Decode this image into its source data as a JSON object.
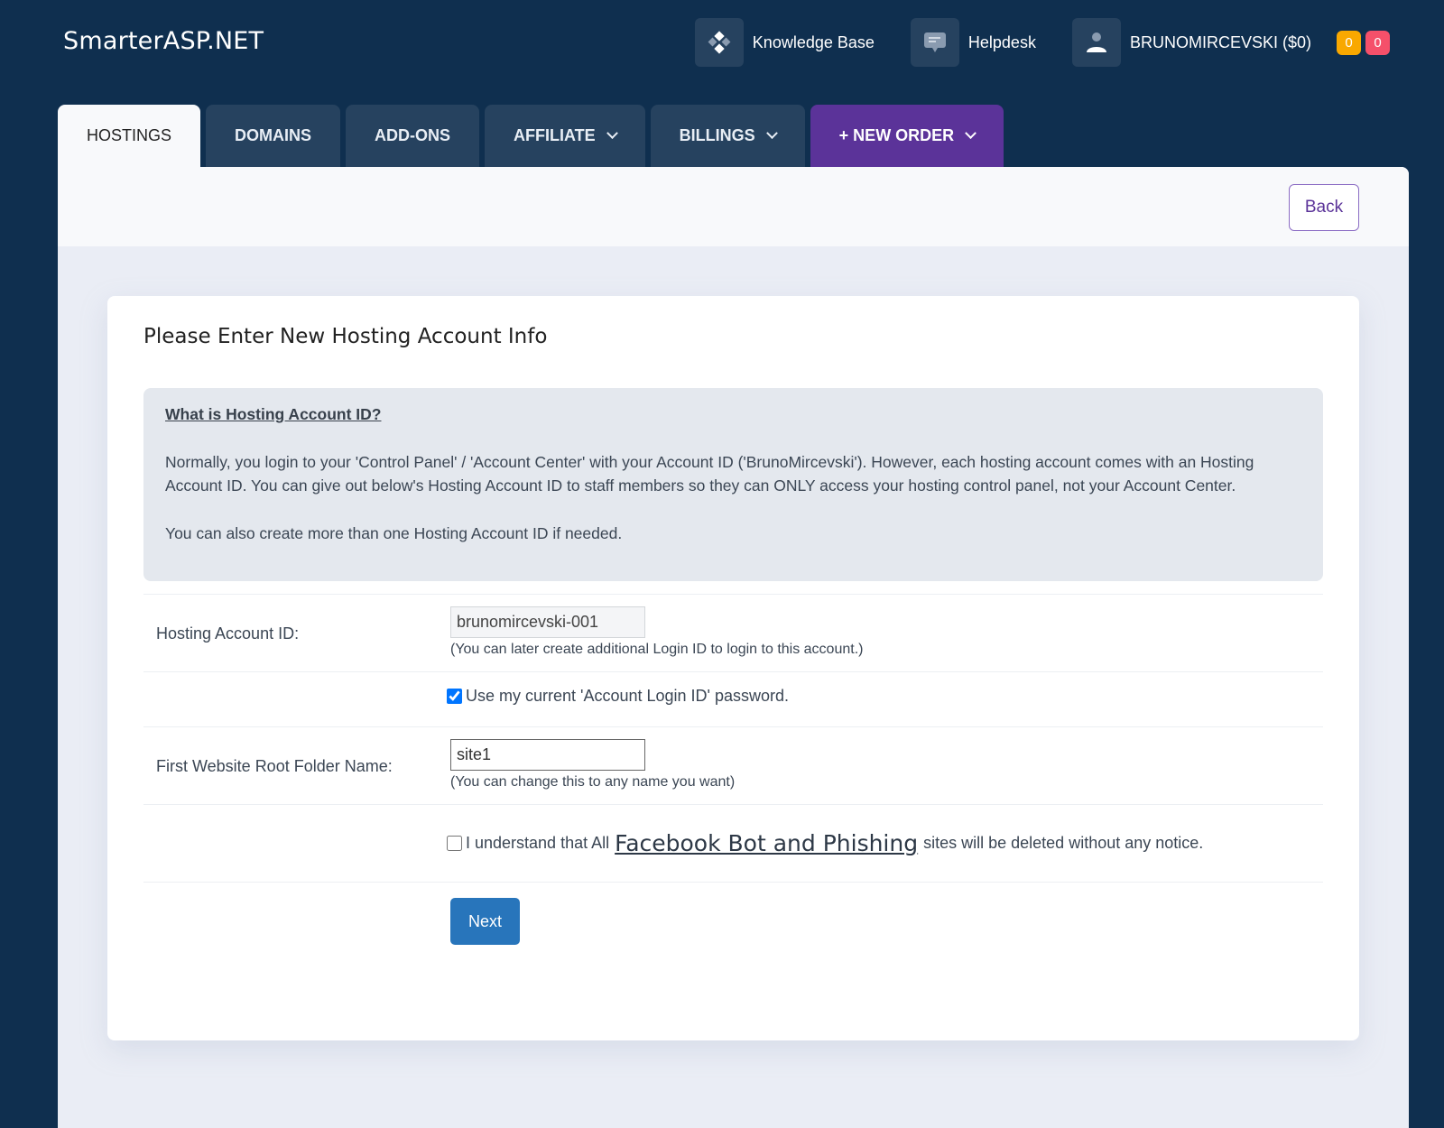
{
  "header": {
    "brand": "SmarterASP.NET",
    "nav": [
      {
        "label": "Knowledge Base",
        "icon": "knowledge-base-icon"
      },
      {
        "label": "Helpdesk",
        "icon": "chat-bubble-icon"
      },
      {
        "label": "BRUNOMIRCEVSKI ($0)",
        "icon": "user-icon"
      }
    ],
    "badges": [
      {
        "value": "0",
        "color": "#f9a800"
      },
      {
        "value": "0",
        "color": "#f5506a"
      }
    ]
  },
  "tabs": [
    {
      "label": "HOSTINGS",
      "active": true,
      "dropdown": false
    },
    {
      "label": "DOMAINS",
      "active": false,
      "dropdown": false
    },
    {
      "label": "ADD-ONS",
      "active": false,
      "dropdown": false
    },
    {
      "label": "AFFILIATE",
      "active": false,
      "dropdown": true
    },
    {
      "label": "BILLINGS",
      "active": false,
      "dropdown": true
    },
    {
      "label": "+ NEW ORDER",
      "active": false,
      "dropdown": true,
      "color": "#5b3399"
    }
  ],
  "toolbar": {
    "back_label": "Back"
  },
  "card": {
    "title": "Please Enter New Hosting Account Info",
    "info": {
      "title": "What is Hosting Account ID?",
      "paragraph1": "Normally, you login to your 'Control Panel' / 'Account Center' with your Account ID ('BrunoMircevski'). However, each hosting account comes with an Hosting Account ID. You can give out below's Hosting Account ID to staff members so they can ONLY access your hosting control panel, not your Account Center.",
      "paragraph2": "You can also create more than one Hosting Account ID if needed."
    },
    "form": {
      "hosting_id_label": "Hosting Account ID:",
      "hosting_id_value": "brunomircevski-001",
      "hosting_id_hint": "(You can later create additional Login ID to login to this account.)",
      "use_password_label": "Use my current 'Account Login ID' password.",
      "use_password_checked": true,
      "root_folder_label": "First Website Root Folder Name:",
      "root_folder_value": "site1",
      "root_folder_hint": "(You can change this to any name you want)",
      "agree_prefix": "I understand that All",
      "agree_link": "Facebook Bot and Phishing",
      "agree_suffix": "sites will be deleted without any notice.",
      "agree_checked": false,
      "next_label": "Next"
    }
  }
}
